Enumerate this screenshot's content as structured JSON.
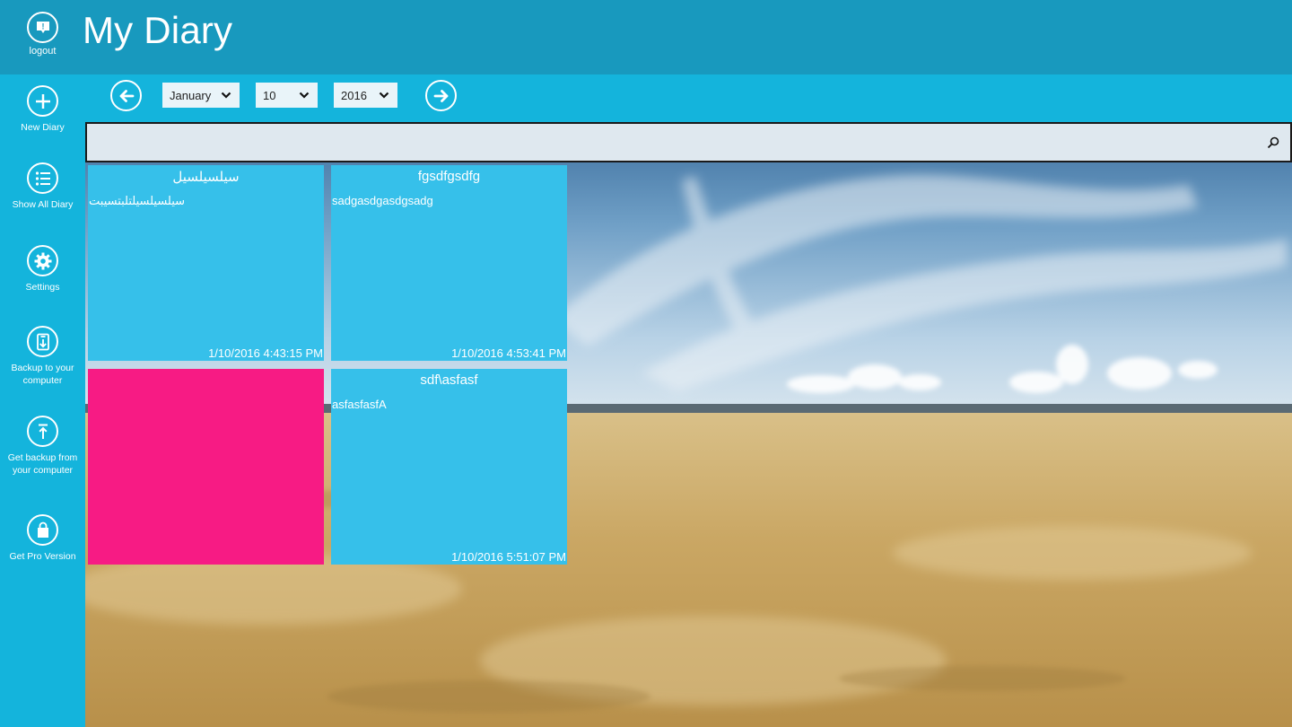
{
  "app": {
    "title": "My Diary"
  },
  "header": {
    "logout_label": "logout"
  },
  "sidebar": {
    "items": [
      {
        "label": "New Diary",
        "icon": "plus-icon"
      },
      {
        "label": "Show All Diary",
        "icon": "list-icon"
      },
      {
        "label": "Settings",
        "icon": "gear-icon"
      },
      {
        "label": "Backup to your computer",
        "icon": "download-icon"
      },
      {
        "label": "Get backup from your computer",
        "icon": "upload-icon"
      },
      {
        "label": "Get Pro Version",
        "icon": "shopping-bag-icon"
      }
    ]
  },
  "toolbar": {
    "month": "January",
    "day": "10",
    "year": "2016",
    "prev_icon": "arrow-left-icon",
    "next_icon": "arrow-right-icon"
  },
  "search": {
    "value": "",
    "placeholder": "",
    "icon": "search-icon"
  },
  "tiles": [
    {
      "title": "سيلسيلسيل",
      "body": "سيلسيلسيلتلبتسيبت",
      "date": "1/10/2016 4:43:15 PM",
      "color": "#36c0ea"
    },
    {
      "title": "fgsdfgsdfg",
      "body": "sadgasdgasdgsadg",
      "date": "1/10/2016 4:53:41 PM",
      "color": "#36c0ea"
    },
    {
      "title": "",
      "body": "",
      "date": "",
      "color": "#f71b84"
    },
    {
      "title": "sdf\\asfasf",
      "body": "asfasfasfA",
      "date": "1/10/2016 5:51:07 PM",
      "color": "#36c0ea"
    }
  ],
  "colors": {
    "header": "#1899be",
    "accent": "#14b4dc",
    "tile_blue": "#36c0ea",
    "tile_pink": "#f71b84"
  }
}
